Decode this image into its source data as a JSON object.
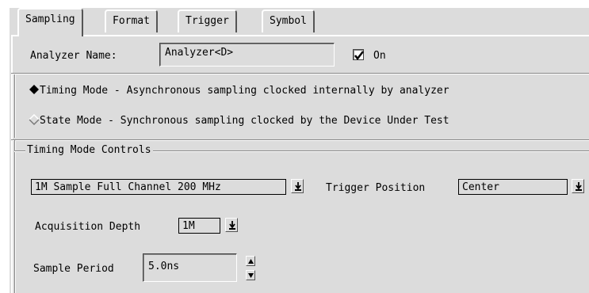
{
  "tabs": [
    "Sampling",
    "Format",
    "Trigger",
    "Symbol"
  ],
  "analyzer": {
    "label": "Analyzer Name:",
    "value": "Analyzer<D>",
    "on_label": "On",
    "on_checked": true
  },
  "modes": {
    "timing": {
      "label": "Timing Mode - Asynchronous sampling clocked internally by analyzer",
      "selected": true
    },
    "state": {
      "label": "State Mode  - Synchronous sampling clocked by the Device Under Test",
      "selected": false
    }
  },
  "timing_controls": {
    "group_label": "Timing Mode Controls",
    "sample_mode": "1M Sample Full Channel 200 MHz",
    "trigger_position_label": "Trigger Position",
    "trigger_position": "Center",
    "acquisition_depth_label": "Acquisition Depth",
    "acquisition_depth": "1M",
    "sample_period_label": "Sample Period",
    "sample_period": "5.0ns"
  },
  "icons": {
    "dropdown": "down-arrow-to-bar-icon",
    "spin_up": "up-arrow-icon",
    "spin_down": "down-arrow-icon",
    "radio_selected": "filled-diamond-icon",
    "radio_unselected": "hollow-diamond-icon",
    "checkbox": "checkmark-icon"
  },
  "colors": {
    "background": "#dcdcdc",
    "highlight": "#ffffff",
    "shadow": "#555555"
  }
}
